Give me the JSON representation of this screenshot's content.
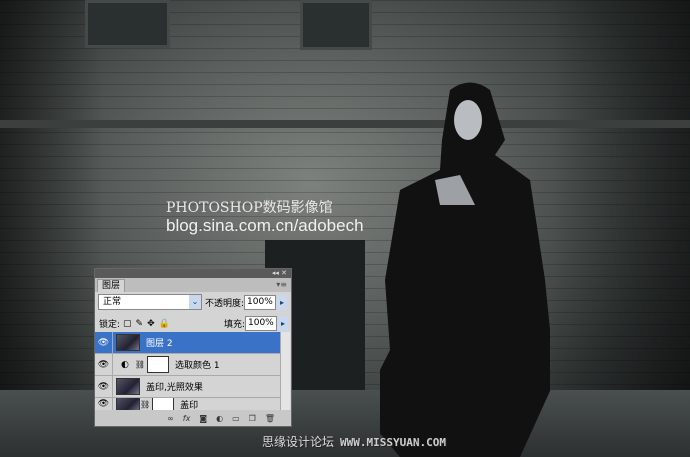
{
  "watermark": {
    "line1": "PHOTOSHOP数码影像馆",
    "line2": "blog.sina.com.cn/adobech",
    "footer_cn": "思缘设计论坛",
    "footer_url": "WWW.MISSYUAN.COM"
  },
  "panel": {
    "collapse_label": "◂◂ ✕",
    "tab": "图层",
    "blend_mode": "正常",
    "opacity_label": "不透明度:",
    "opacity_value": "100%",
    "lock_label": "锁定:",
    "fill_label": "填充:",
    "fill_value": "100%",
    "layers": [
      {
        "name": "图层 2",
        "selected": true
      },
      {
        "name": "选取颜色 1",
        "selected": false
      },
      {
        "name": "盖印,光照效果",
        "selected": false
      },
      {
        "name": "盖印",
        "selected": false
      }
    ],
    "accent": "#3a72c8"
  }
}
